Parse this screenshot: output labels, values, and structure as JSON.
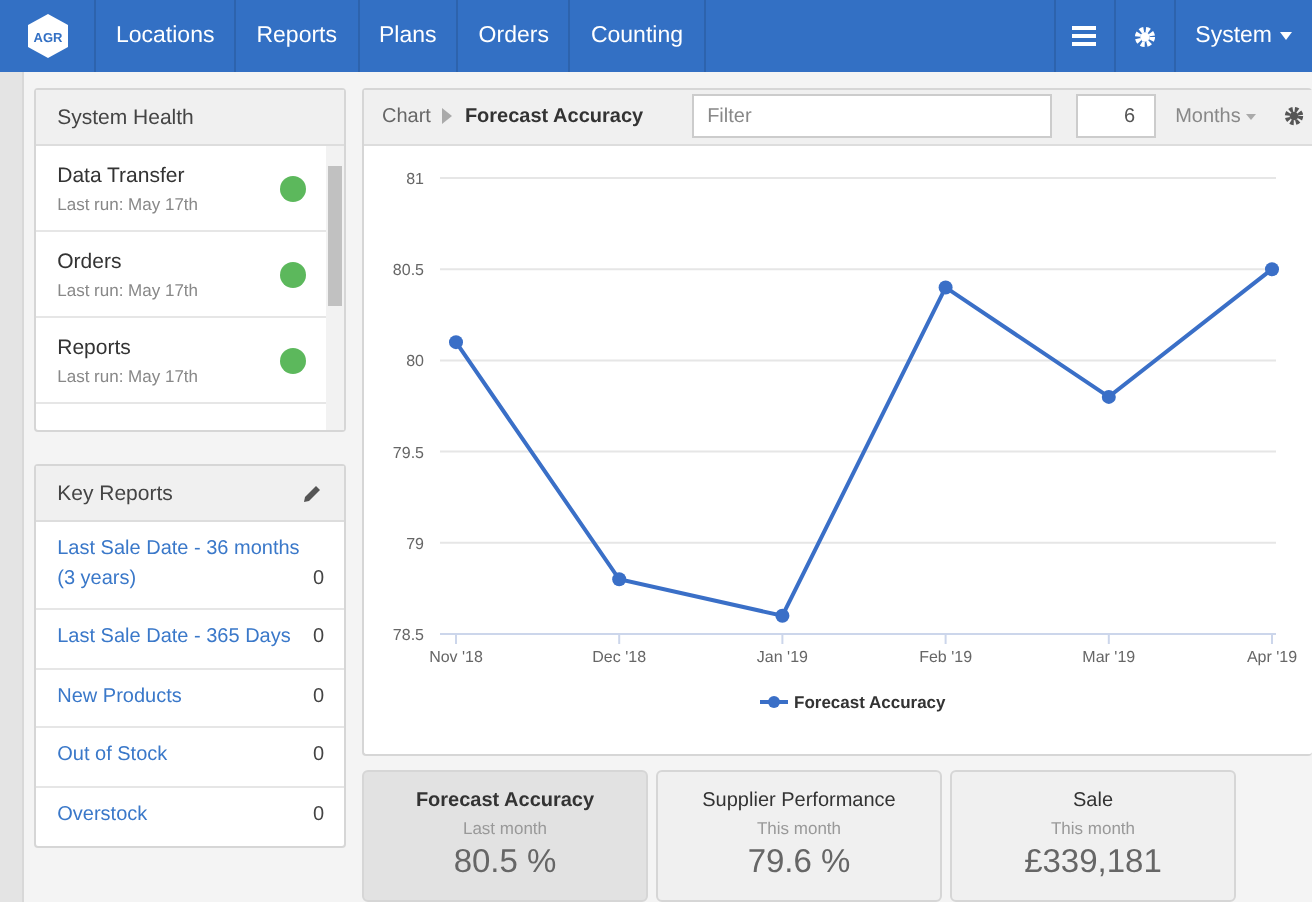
{
  "nav": {
    "logo": "AGR",
    "items": [
      "Locations",
      "Reports",
      "Plans",
      "Orders",
      "Counting"
    ],
    "system": "System"
  },
  "system_health": {
    "title": "System Health",
    "items": [
      {
        "name": "Data Transfer",
        "last_run": "Last run: May 17th",
        "color": "#5cb85c"
      },
      {
        "name": "Orders",
        "last_run": "Last run: May 17th",
        "color": "#5cb85c"
      },
      {
        "name": "Reports",
        "last_run": "Last run: May 17th",
        "color": "#5cb85c"
      }
    ]
  },
  "key_reports": {
    "title": "Key Reports",
    "items": [
      {
        "label": "Last Sale Date - 36 months (3 years)",
        "count": "0"
      },
      {
        "label": "Last Sale Date - 365 Days",
        "count": "0"
      },
      {
        "label": "New Products",
        "count": "0"
      },
      {
        "label": "Out of Stock",
        "count": "0"
      },
      {
        "label": "Overstock",
        "count": "0"
      }
    ]
  },
  "chart_panel": {
    "breadcrumb": "Chart",
    "title": "Forecast Accuracy",
    "filter": {
      "placeholder": "Filter"
    },
    "months_value": "6",
    "period": "Months",
    "chart_data": {
      "type": "line",
      "categories": [
        "Nov '18",
        "Dec '18",
        "Jan '19",
        "Feb '19",
        "Mar '19",
        "Apr '19"
      ],
      "series": [
        {
          "name": "Forecast Accuracy",
          "color": "#3a6fc7",
          "marker": true,
          "values": [
            80.1,
            78.8,
            78.6,
            80.4,
            79.8,
            80.5
          ]
        }
      ],
      "grid": true,
      "ylim": [
        78.5,
        81
      ],
      "yticks": [
        78.5,
        79,
        79.5,
        80,
        80.5,
        81
      ]
    }
  },
  "kpis": [
    {
      "title": "Forecast Accuracy",
      "period": "Last month",
      "value": "80.5 %",
      "selected": true
    },
    {
      "title": "Supplier Performance",
      "period": "This month",
      "value": "79.6 %",
      "selected": false
    },
    {
      "title": "Sale",
      "period": "This month",
      "value": "£339,181",
      "selected": false
    }
  ]
}
